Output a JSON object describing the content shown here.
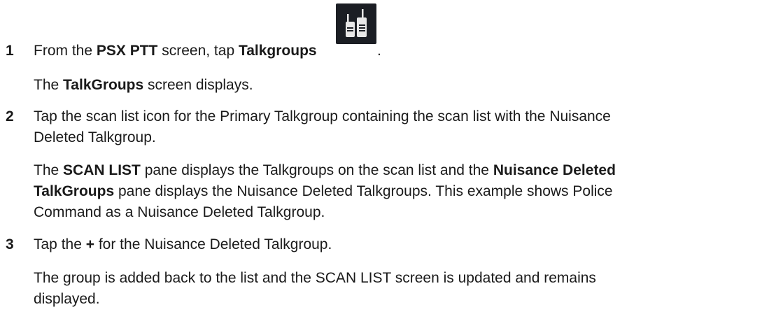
{
  "steps": [
    {
      "number": "1",
      "line_pre": "From the ",
      "line_b1": "PSX PTT",
      "line_mid": " screen, tap ",
      "line_b2": "Talkgroups",
      "line_post": ".",
      "icon": "walkie-talkie-pair-icon",
      "result_pre": "The ",
      "result_b": "TalkGroups",
      "result_post": " screen displays."
    },
    {
      "number": "2",
      "line1": "Tap the scan list icon for the Primary Talkgroup containing the scan list with the Nuisance",
      "line2": "Deleted Talkgroup.",
      "result_l1_pre": "The ",
      "result_l1_b1": "SCAN LIST",
      "result_l1_mid": " pane displays the Talkgroups on the scan list and the ",
      "result_l1_b2": "Nuisance Deleted",
      "result_l2_b": "TalkGroups",
      "result_l2_post": " pane displays the Nuisance Deleted Talkgroups. This example shows Police",
      "result_l3": "Command as a Nuisance Deleted Talkgroup."
    },
    {
      "number": "3",
      "line_pre": "Tap the ",
      "line_b": "+",
      "line_post": " for the Nuisance Deleted Talkgroup.",
      "result_l1": "The group is added back to the list and the SCAN LIST screen is updated and remains",
      "result_l2": "displayed."
    }
  ]
}
